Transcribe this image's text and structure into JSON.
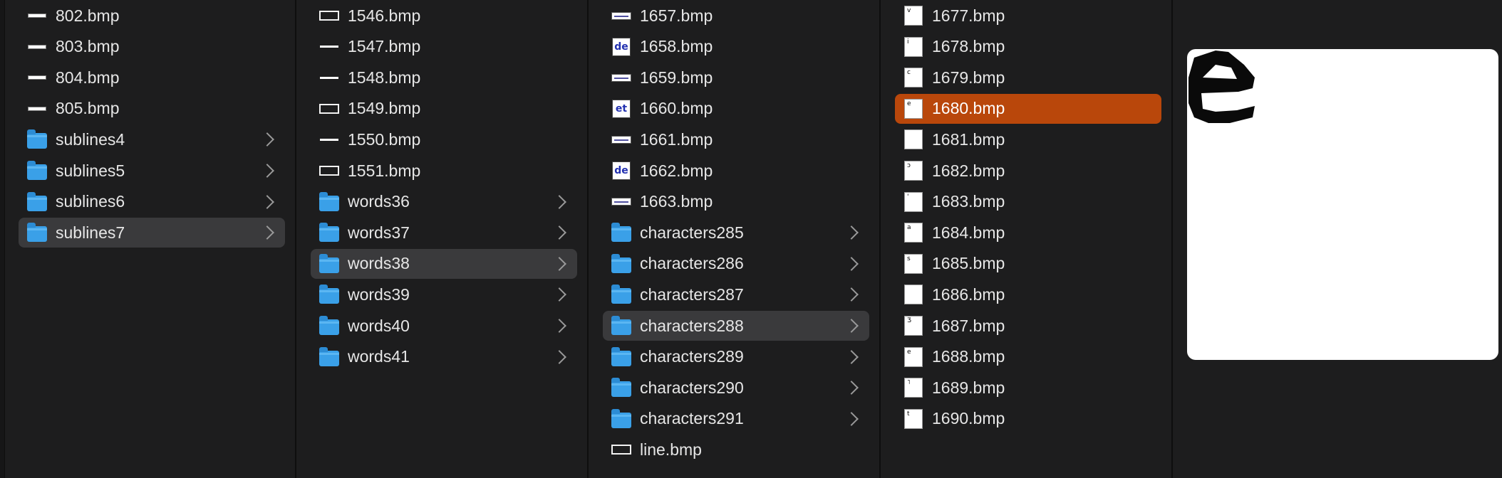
{
  "columns": [
    {
      "items": [
        {
          "label": "802.bmp",
          "type": "file",
          "thumb": "strip"
        },
        {
          "label": "803.bmp",
          "type": "file",
          "thumb": "strip"
        },
        {
          "label": "804.bmp",
          "type": "file",
          "thumb": "strip"
        },
        {
          "label": "805.bmp",
          "type": "file",
          "thumb": "strip"
        },
        {
          "label": "sublines4",
          "type": "folder"
        },
        {
          "label": "sublines5",
          "type": "folder"
        },
        {
          "label": "sublines6",
          "type": "folder"
        },
        {
          "label": "sublines7",
          "type": "folder",
          "selected": true
        }
      ]
    },
    {
      "items": [
        {
          "label": "1546.bmp",
          "type": "file",
          "thumb": "rect"
        },
        {
          "label": "1547.bmp",
          "type": "file",
          "thumb": "line"
        },
        {
          "label": "1548.bmp",
          "type": "file",
          "thumb": "line"
        },
        {
          "label": "1549.bmp",
          "type": "file",
          "thumb": "rect"
        },
        {
          "label": "1550.bmp",
          "type": "file",
          "thumb": "line"
        },
        {
          "label": "1551.bmp",
          "type": "file",
          "thumb": "rect"
        },
        {
          "label": "words36",
          "type": "folder"
        },
        {
          "label": "words37",
          "type": "folder"
        },
        {
          "label": "words38",
          "type": "folder",
          "selected": true
        },
        {
          "label": "words39",
          "type": "folder"
        },
        {
          "label": "words40",
          "type": "folder"
        },
        {
          "label": "words41",
          "type": "folder"
        }
      ]
    },
    {
      "items": [
        {
          "label": "1657.bmp",
          "type": "file",
          "thumb": "word"
        },
        {
          "label": "1658.bmp",
          "type": "file",
          "thumb": "big",
          "glyph": "de"
        },
        {
          "label": "1659.bmp",
          "type": "file",
          "thumb": "word"
        },
        {
          "label": "1660.bmp",
          "type": "file",
          "thumb": "big",
          "glyph": "et"
        },
        {
          "label": "1661.bmp",
          "type": "file",
          "thumb": "word"
        },
        {
          "label": "1662.bmp",
          "type": "file",
          "thumb": "big",
          "glyph": "de"
        },
        {
          "label": "1663.bmp",
          "type": "file",
          "thumb": "word"
        },
        {
          "label": "characters285",
          "type": "folder"
        },
        {
          "label": "characters286",
          "type": "folder"
        },
        {
          "label": "characters287",
          "type": "folder"
        },
        {
          "label": "characters288",
          "type": "folder",
          "selected": true
        },
        {
          "label": "characters289",
          "type": "folder"
        },
        {
          "label": "characters290",
          "type": "folder"
        },
        {
          "label": "characters291",
          "type": "folder"
        },
        {
          "label": "line.bmp",
          "type": "file",
          "thumb": "rect"
        }
      ]
    },
    {
      "items": [
        {
          "label": "1677.bmp",
          "type": "file",
          "thumb": "char",
          "glyph": "v"
        },
        {
          "label": "1678.bmp",
          "type": "file",
          "thumb": "char",
          "glyph": "i"
        },
        {
          "label": "1679.bmp",
          "type": "file",
          "thumb": "char",
          "glyph": "c"
        },
        {
          "label": "1680.bmp",
          "type": "file",
          "thumb": "char",
          "glyph": "e",
          "active": true
        },
        {
          "label": "1681.bmp",
          "type": "file",
          "thumb": "char",
          "glyph": ""
        },
        {
          "label": "1682.bmp",
          "type": "file",
          "thumb": "char",
          "glyph": "ɔ"
        },
        {
          "label": "1683.bmp",
          "type": "file",
          "thumb": "char",
          "glyph": "'"
        },
        {
          "label": "1684.bmp",
          "type": "file",
          "thumb": "char",
          "glyph": "a"
        },
        {
          "label": "1685.bmp",
          "type": "file",
          "thumb": "char",
          "glyph": "s"
        },
        {
          "label": "1686.bmp",
          "type": "file",
          "thumb": "char",
          "glyph": ""
        },
        {
          "label": "1687.bmp",
          "type": "file",
          "thumb": "char",
          "glyph": "Ʒ"
        },
        {
          "label": "1688.bmp",
          "type": "file",
          "thumb": "char",
          "glyph": "e"
        },
        {
          "label": "1689.bmp",
          "type": "file",
          "thumb": "char",
          "glyph": "˥"
        },
        {
          "label": "1690.bmp",
          "type": "file",
          "thumb": "char",
          "glyph": "t"
        }
      ]
    }
  ],
  "colors": {
    "accent": "#b9470b",
    "folder": "#3aa0e8",
    "selection": "#3a3a3c",
    "background": "#1d1d1e"
  }
}
